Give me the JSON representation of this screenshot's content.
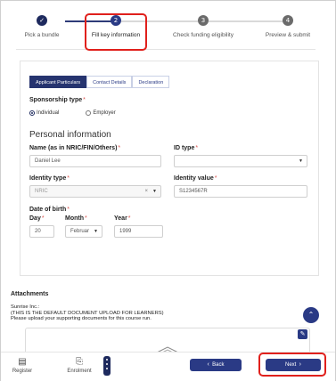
{
  "stepper": {
    "steps": [
      {
        "number": "✓",
        "label": "Pick a bundle",
        "state": "done"
      },
      {
        "number": "2",
        "label": "Fill key information",
        "state": "active"
      },
      {
        "number": "3",
        "label": "Check funding eligibility",
        "state": "pending"
      },
      {
        "number": "4",
        "label": "Preview & submit",
        "state": "pending"
      }
    ]
  },
  "tabs": [
    "Applicant Particulars",
    "Contact Details",
    "Declaration"
  ],
  "form": {
    "sponsorship_label": "Sponsorship type",
    "sponsorship_options": [
      "Individual",
      "Employer"
    ],
    "sponsorship_selected": "Individual",
    "personal_info_title": "Personal information",
    "name_label": "Name (as in NRIC/FIN/Others)",
    "name_value": "Daniel Lee",
    "id_type_label": "ID type",
    "id_type_value": "",
    "identity_type_label": "Identity type",
    "identity_type_value": "NRIC",
    "identity_value_label": "Identity value",
    "identity_value_value": "S1234567R",
    "dob_label": "Date of birth",
    "day_label": "Day",
    "day_value": "20",
    "month_label": "Month",
    "month_value": "Februar",
    "year_label": "Year",
    "year_value": "1999",
    "required_mark": "*"
  },
  "attachments": {
    "title": "Attachments",
    "org_name": "Sunrise Inc.:",
    "note1": "(THIS IS THE DEFAULT DOCUMENT UPLOAD FOR LEARNERS)",
    "note2": "Please upload your supporting documents for this course run."
  },
  "bottom_bar": {
    "register_label": "Register",
    "enrolment_label": "Enrolment",
    "back_label": "Back",
    "next_label": "Next"
  },
  "colors": {
    "primary": "#2a3a85",
    "highlight": "#e0201c",
    "required": "#d9534f"
  }
}
